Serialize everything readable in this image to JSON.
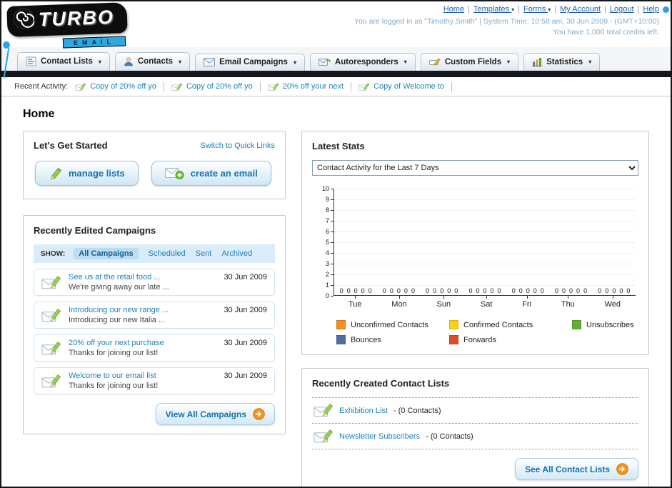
{
  "page_title": "Home",
  "colors": {
    "link": "#1e82b4",
    "accent_orange": "#f7941d",
    "nav_dark": "#15151d",
    "logo_blue": "#2ea8e0"
  },
  "header": {
    "logo_title": "TURBO",
    "logo_subtitle": "EMAIL",
    "top_links": [
      {
        "label": "Home",
        "caret": false
      },
      {
        "label": "Templates",
        "caret": true
      },
      {
        "label": "Forms",
        "caret": true
      },
      {
        "label": "My Account",
        "caret": false
      },
      {
        "label": "Logout",
        "caret": false
      },
      {
        "label": "Help",
        "caret": false
      }
    ],
    "login_status": "You are logged in as \"Timothy Smith\" | System Time: 10:58 am, 30 Jun 2009 - (GMT+10:00)",
    "credits": "You have 1,000 total credits left."
  },
  "nav": {
    "tabs": [
      {
        "label": "Contact Lists",
        "icon": "contact-lists-icon"
      },
      {
        "label": "Contacts",
        "icon": "contacts-icon"
      },
      {
        "label": "Email Campaigns",
        "icon": "email-campaigns-icon"
      },
      {
        "label": "Autoresponders",
        "icon": "autoresponders-icon"
      },
      {
        "label": "Custom Fields",
        "icon": "custom-fields-icon"
      },
      {
        "label": "Statistics",
        "icon": "statistics-icon"
      }
    ]
  },
  "recent_activity": {
    "label": "Recent Activity:",
    "item_icon": "envelope-small-icon",
    "items": [
      "Copy of 20% off yo",
      "Copy of 20% off yo",
      "20% off your next",
      "Copy of Welcome to"
    ]
  },
  "get_started": {
    "title": "Let's Get Started",
    "switch_link": "Switch to Quick Links",
    "manage_button": "manage lists",
    "create_button": "create an email"
  },
  "campaigns": {
    "title": "Recently Edited Campaigns",
    "show_label": "SHOW:",
    "filters": [
      "All Campaigns",
      "Scheduled",
      "Sent",
      "Archived"
    ],
    "selected_filter": "All Campaigns",
    "item_icon": "envelope-pencil-icon",
    "items": [
      {
        "title": "See us at the retail food ...",
        "subtitle": "We're giving away our late ...",
        "date": "30 Jun 2009"
      },
      {
        "title": "Introducing our new range ...",
        "subtitle": "Introducing our new Italia ...",
        "date": "30 Jun 2009"
      },
      {
        "title": "20% off your next purchase",
        "subtitle": "Thanks for joining our list!",
        "date": "30 Jun 2009"
      },
      {
        "title": "Welcome to our email list",
        "subtitle": "Thanks for joining our list!",
        "date": "30 Jun 2009"
      }
    ],
    "view_all_label": "View All Campaigns"
  },
  "stats": {
    "title": "Latest Stats",
    "period_selected": "Contact Activity for the Last 7 Days",
    "chart_data": {
      "type": "bar",
      "title": "Contact Activity for the Last 7 Days",
      "categories": [
        "Tue",
        "Mon",
        "Sun",
        "Sat",
        "Fri",
        "Thu",
        "Wed"
      ],
      "series": [
        {
          "name": "Unconfirmed Contacts",
          "color": "#f28f20",
          "values": [
            0,
            0,
            0,
            0,
            0,
            0,
            0
          ]
        },
        {
          "name": "Confirmed Contacts",
          "color": "#fdd017",
          "values": [
            0,
            0,
            0,
            0,
            0,
            0,
            0
          ]
        },
        {
          "name": "Unsubscribes",
          "color": "#61b031",
          "values": [
            0,
            0,
            0,
            0,
            0,
            0,
            0
          ]
        },
        {
          "name": "Bounces",
          "color": "#4f6e9e",
          "values": [
            0,
            0,
            0,
            0,
            0,
            0,
            0
          ]
        },
        {
          "name": "Forwards",
          "color": "#e04a26",
          "values": [
            0,
            0,
            0,
            0,
            0,
            0,
            0
          ]
        }
      ],
      "xlabel": "",
      "ylabel": "",
      "ylim": [
        0,
        10
      ],
      "ytick_step": 1,
      "grid": false,
      "legend_position": "bottom"
    }
  },
  "contact_lists": {
    "title": "Recently Created Contact Lists",
    "item_icon": "envelope-pencil-icon",
    "items": [
      {
        "name": "Exhibition List",
        "count": "(0 Contacts)"
      },
      {
        "name": "Newsletter Subscribers",
        "count": "(0 Contacts)"
      }
    ],
    "see_all_label": "See All Contact Lists"
  }
}
